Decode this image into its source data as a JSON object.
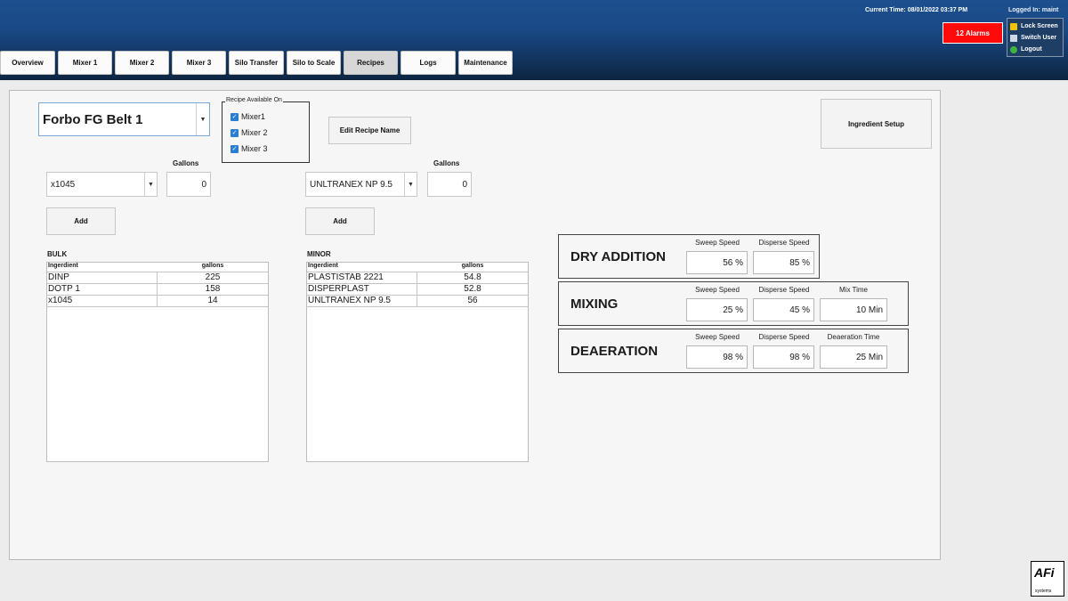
{
  "header": {
    "current_time": "Current Time: 08/01/2022 03:37 PM",
    "logged_in": "Logged In: maint",
    "alarms": "12 Alarms",
    "user_menu": [
      "Lock Screen",
      "Switch User",
      "Logout"
    ]
  },
  "tabs": [
    "Overview",
    "Mixer 1",
    "Mixer 2",
    "Mixer 3",
    "Silo Transfer",
    "Silo to Scale",
    "Recipes",
    "Logs",
    "Maintenance"
  ],
  "active_tab": "Recipes",
  "recipe": {
    "name": "Forbo FG Belt 1",
    "available_on_title": "Recipe Available On",
    "mixers": [
      "Mixer1",
      "Mixer 2",
      "Mixer 3"
    ],
    "mixers_checked": [
      true,
      true,
      true
    ],
    "edit_name_label": "Edit Recipe Name",
    "ingredient_setup_label": "Ingredient Setup"
  },
  "bulk": {
    "gallons_label": "Gallons",
    "selected": "x1045",
    "gallons": "0",
    "add_label": "Add",
    "title": "BULK",
    "columns": [
      "Ingerdient",
      "gallons"
    ],
    "rows": [
      [
        "DINP",
        "225"
      ],
      [
        "DOTP 1",
        "158"
      ],
      [
        "x1045",
        "14"
      ]
    ]
  },
  "minor": {
    "gallons_label": "Gallons",
    "selected": "UNLTRANEX NP 9.5",
    "gallons": "0",
    "add_label": "Add",
    "title": "MINOR",
    "columns": [
      "Ingerdient",
      "gallons"
    ],
    "rows": [
      [
        "PLASTISTAB 2221",
        "54.8"
      ],
      [
        "DISPERPLAST",
        "52.8"
      ],
      [
        "UNLTRANEX NP 9.5",
        "56"
      ]
    ]
  },
  "process": {
    "dry_addition": {
      "title": "DRY ADDITION",
      "labels": [
        "Sweep Speed",
        "Disperse Speed"
      ],
      "values": [
        "56 %",
        "85 %"
      ]
    },
    "mixing": {
      "title": "MIXING",
      "labels": [
        "Sweep Speed",
        "Disperse Speed",
        "Mix Time"
      ],
      "values": [
        "25 %",
        "45 %",
        "10 Min"
      ]
    },
    "deaeration": {
      "title": "DEAERATION",
      "labels": [
        "Sweep Speed",
        "Disperse Speed",
        "Deaeration Time"
      ],
      "values": [
        "98 %",
        "98 %",
        "25 Min"
      ]
    }
  },
  "logo": {
    "mark": "AFi",
    "sub": "systems"
  },
  "colors": {
    "header": "#1a4a86",
    "alarm": "#ff0a0a",
    "checkbox": "#2a7ed3"
  }
}
